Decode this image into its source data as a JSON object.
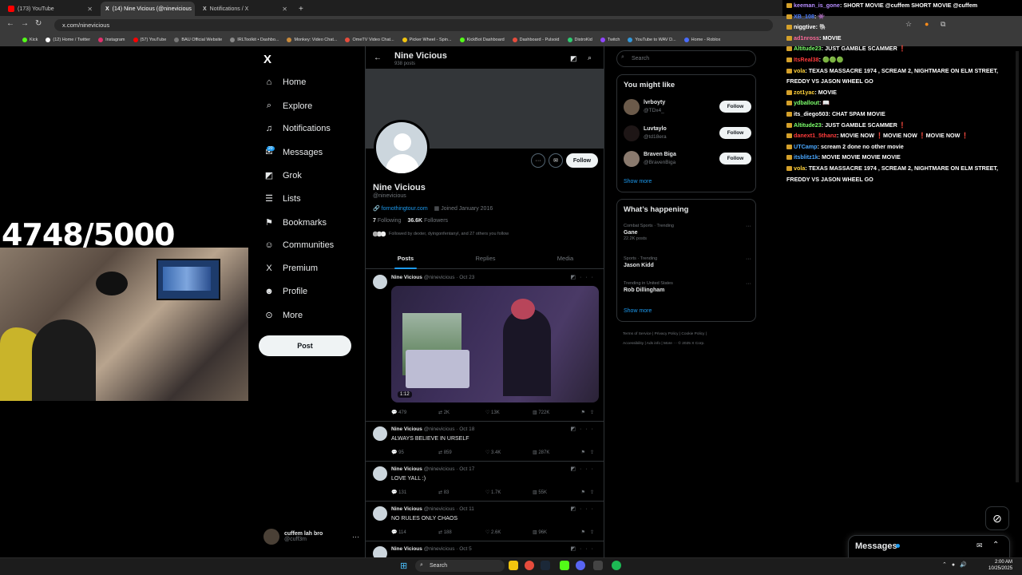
{
  "browser": {
    "tabs": [
      {
        "label": "(173) YouTube",
        "color": "#ff0000"
      },
      {
        "label": "(14) Nine Vicious (@ninevicious",
        "color": "#ffffff"
      },
      {
        "label": "Notifications / X",
        "color": "#ffffff"
      }
    ],
    "new_tab": "+",
    "url": "x.com/ninevicious",
    "bookmarks": [
      "Kick",
      "(12) Home / Twitter",
      "Instagram",
      "(57) YouTube",
      "BAU Official Website",
      "IRLToolkit • Dashbo...",
      "Monkey: Video Chat...",
      "OmeTV Video Chat...",
      "Picker Wheel - Spin...",
      "KickBot Dashboard",
      "Dashboard - Pulsoid",
      "DistroKid",
      "Twitch",
      "YouTube to WAV D...",
      "Home - Roblox"
    ],
    "all_bookmarks": "All Bookmarks"
  },
  "overlay": {
    "counter": "4748/5000"
  },
  "x_nav": {
    "logo": "X",
    "items": [
      {
        "label": "Home",
        "icon": "home-icon",
        "glyph": "⌂"
      },
      {
        "label": "Explore",
        "icon": "search-icon",
        "glyph": "⌕"
      },
      {
        "label": "Notifications",
        "icon": "bell-icon",
        "glyph": "♫"
      },
      {
        "label": "Messages",
        "icon": "mail-icon",
        "glyph": "✉"
      },
      {
        "label": "Grok",
        "icon": "grok-icon",
        "glyph": "◩"
      },
      {
        "label": "Lists",
        "icon": "list-icon",
        "glyph": "☰"
      },
      {
        "label": "Bookmarks",
        "icon": "bookmark-icon",
        "glyph": "⚑"
      },
      {
        "label": "Communities",
        "icon": "communities-icon",
        "glyph": "☺"
      },
      {
        "label": "Premium",
        "icon": "x-premium-icon",
        "glyph": "X"
      },
      {
        "label": "Profile",
        "icon": "profile-icon",
        "glyph": "☻"
      },
      {
        "label": "More",
        "icon": "more-icon",
        "glyph": "⊙"
      }
    ],
    "messages_badge": "20",
    "post_button": "Post",
    "account": {
      "name": "cuffem lah bro",
      "handle": "@cuff3m",
      "menu": "···"
    }
  },
  "profile": {
    "header_name": "Nine Vicious",
    "header_posts": "938 posts",
    "name": "Nine Vicious",
    "handle": "@ninevicious",
    "link": "fornothingtour.com",
    "joined": "Joined January 2016",
    "following_count": "7",
    "following_label": "Following",
    "followers_count": "36.6K",
    "followers_label": "Followers",
    "followed_by": "Followed by dexter, dyingonfentanyl, and 27 others you follow",
    "follow_button": "Follow",
    "tabs": [
      "Posts",
      "Replies",
      "Media"
    ]
  },
  "tweets": [
    {
      "name": "Nine Vicious",
      "meta": "@ninevicious · Oct 23",
      "text": "",
      "video_duration": "1:12",
      "replies": "479",
      "reposts": "2K",
      "likes": "13K",
      "views": "722K"
    },
    {
      "name": "Nine Vicious",
      "meta": "@ninevicious · Oct 18",
      "text": "ALWAYS BELIEVE IN URSELF",
      "replies": "95",
      "reposts": "859",
      "likes": "3.4K",
      "views": "287K"
    },
    {
      "name": "Nine Vicious",
      "meta": "@ninevicious · Oct 17",
      "text": "LOVE YALL :)",
      "replies": "131",
      "reposts": "83",
      "likes": "1.7K",
      "views": "55K"
    },
    {
      "name": "Nine Vicious",
      "meta": "@ninevicious · Oct 11",
      "text": "NO RULES ONLY CHAOS",
      "replies": "114",
      "reposts": "188",
      "likes": "2.6K",
      "views": "96K"
    },
    {
      "name": "Nine Vicious",
      "meta": "@ninevicious · Oct 5",
      "text": ""
    }
  ],
  "sidebar": {
    "search_placeholder": "Search",
    "you_might_like": "You might like",
    "suggestions": [
      {
        "name": "lvrboyty",
        "handle": "@TDx4_",
        "button": "Follow"
      },
      {
        "name": "Luvtaylo",
        "handle": "@td18era",
        "button": "Follow"
      },
      {
        "name": "Braven Biga",
        "handle": "@BravenBiga",
        "button": "Follow"
      }
    ],
    "show_more": "Show more",
    "whats_happening": "What’s happening",
    "trends": [
      {
        "category": "Combat Sports · Trending",
        "name": "Gane",
        "posts": "22.2K posts"
      },
      {
        "category": "Sports · Trending",
        "name": "Jason Kidd",
        "posts": ""
      },
      {
        "category": "Trending in United States",
        "name": "Rob Dillingham",
        "posts": ""
      }
    ],
    "footer_line1": "Terms of Service  |  Privacy Policy  |  Cookie Policy  |",
    "footer_line2": "Accessibility  |  Ads info  |  More ···  © 2025 X Corp."
  },
  "chat": [
    {
      "user": "keeman_is_gone",
      "color": "#b68cff",
      "msg": "SHORT MOVIE @cuffem SHORT MOVIE @cuffem"
    },
    {
      "user": "XB_108",
      "color": "#4a7bff",
      "msg": "👾"
    },
    {
      "user": "niggtive",
      "color": "#ffffff",
      "msg": "🐘"
    },
    {
      "user": "ad1nross",
      "color": "#ff6b9a",
      "msg": "MOVIE"
    },
    {
      "user": "Altitude23",
      "color": "#7cff6b",
      "msg": "JUST GAMBLE SCAMMER ❗"
    },
    {
      "user": "ItsReal38",
      "color": "#ff3b3b",
      "msg": "🟢🟢🟢"
    },
    {
      "user": "vola",
      "color": "#ffd23b",
      "msg": "TEXAS MASSACRE 1974 , SCREAM 2, NIGHTMARE ON ELM STREET, FREDDY VS JASON WHEEL GO"
    },
    {
      "user": "zot1yac",
      "color": "#ffd23b",
      "msg": "MOVIE"
    },
    {
      "user": "ydballout",
      "color": "#7cff6b",
      "msg": "📖"
    },
    {
      "user": "its_diego503",
      "color": "#ffffff",
      "msg": "CHAT SPAM MOVIE"
    },
    {
      "user": "Altitude23",
      "color": "#7cff6b",
      "msg": "JUST GAMBLE SCAMMER ❗"
    },
    {
      "user": "danext1_5thanz",
      "color": "#ff3b3b",
      "msg": "MOVIE NOW ❗MOVIE NOW ❗MOVIE NOW ❗"
    },
    {
      "user": "UTCamp",
      "color": "#4aa8ff",
      "msg": "scream 2 done no other movie"
    },
    {
      "user": "itsblitz1k",
      "color": "#4aa8ff",
      "msg": "MOVIE MOVIE MOVIE MOVIE"
    },
    {
      "user": "vola",
      "color": "#ffd23b",
      "msg": "TEXAS MASSACRE 1974 , SCREAM 2, NIGHTMARE ON ELM STREET, FREDDY VS JASON WHEEL GO"
    }
  ],
  "messages_drawer": {
    "label": "Messages"
  },
  "taskbar": {
    "search": "Search",
    "time": "2:00 AM",
    "date": "10/25/2025"
  }
}
